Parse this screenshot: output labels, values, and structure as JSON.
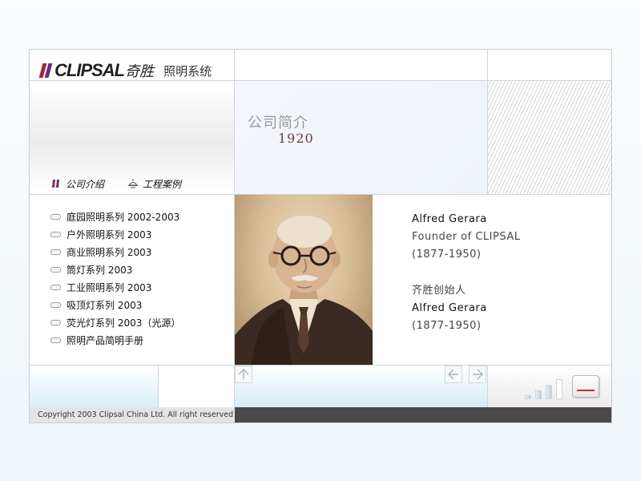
{
  "header": {
    "brand": "CLIPSAL",
    "brand_cn": "奇胜",
    "subtitle": "照明系统"
  },
  "nav": {
    "items": [
      {
        "label": "公司介绍",
        "icon": "clipsal-logo-icon"
      },
      {
        "label": "工程案例",
        "icon": "lamp-icon"
      }
    ]
  },
  "page": {
    "title": "公司简介",
    "year": "1920"
  },
  "series": [
    "庭园照明系列  2002-2003",
    "户外照明系列  2003",
    "商业照明系列  2003",
    "筒灯系列  2003",
    "工业照明系列  2003",
    "吸顶灯系列  2003",
    "荧光灯系列  2003（光源）",
    "照明产品简明手册"
  ],
  "bio": {
    "name_en": "Alfred Gerara",
    "role_en": "Founder of CLIPSAL",
    "years_en": "(1877-1950)",
    "role_cn": "齐胜创始人",
    "name_cn": "Alfred Gerara",
    "years_cn": "(1877-1950)"
  },
  "footer": {
    "copyright": "Copyright 2003 Clipsal China Ltd. All right reserved"
  },
  "colors": {
    "stripe_1": "#a3263a",
    "stripe_2": "#6a2d7e",
    "accent_red": "#d22a2a",
    "footer_dark": "#4c4848"
  }
}
